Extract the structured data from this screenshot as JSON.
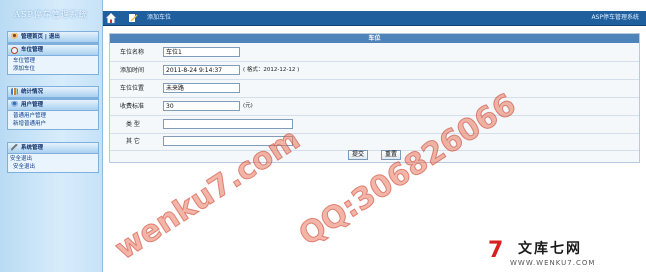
{
  "app": {
    "logo_text": "ASP停车管理系统"
  },
  "sidebar": {
    "panels": [
      {
        "title": "管理首页 | 退出",
        "links": []
      },
      {
        "title": "车位管理",
        "links": [
          "车位管理",
          "添加车位"
        ]
      },
      {
        "title": "统计情况",
        "links": []
      },
      {
        "title": "用户管理",
        "links": [
          "普通用户管理",
          "新增普通用户"
        ]
      },
      {
        "title": "系统管理",
        "links": [
          "安全退出",
          "安全退出"
        ]
      }
    ]
  },
  "topbar": {
    "breadcrumb": "添加车位",
    "system_name": "ASP停车管理系统"
  },
  "form": {
    "title": "车位",
    "fields": [
      {
        "label": "车位名称",
        "value": "车位1",
        "hint": ""
      },
      {
        "label": "添加时间",
        "value": "2011-8-24 9:14:37",
        "hint": "( 格式：2012-12-12 )"
      },
      {
        "label": "车位位置",
        "value": "未来路",
        "hint": ""
      },
      {
        "label": "收费标准",
        "value": "30",
        "hint": "(元)"
      },
      {
        "label": "类  型",
        "value": "",
        "hint": ""
      },
      {
        "label": "其  它",
        "value": "",
        "hint": ""
      }
    ],
    "submit_label": "提交",
    "reset_label": "重置"
  },
  "watermark": {
    "text1": "wenku7.com",
    "text2": "QQ:306826066"
  },
  "brand": {
    "mark": "7",
    "name": "文库七网",
    "url": "WWW.WENKU7.COM"
  },
  "colors": {
    "topbar": "#1f5f9e",
    "form_title": "#4f84ba",
    "watermark": "#e9785f",
    "brand_red": "#d82020"
  }
}
